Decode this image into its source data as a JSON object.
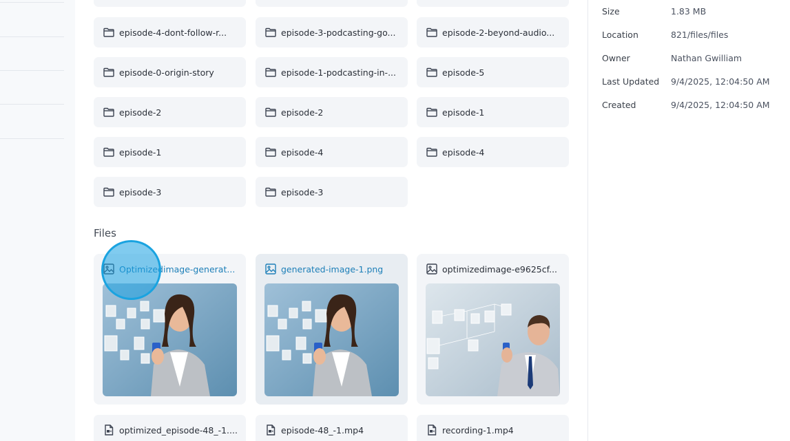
{
  "folders": [
    {
      "name": "episode-4-dont-follow-r..."
    },
    {
      "name": "episode-3-podcasting-go..."
    },
    {
      "name": "episode-2-beyond-audio..."
    },
    {
      "name": "episode-0-origin-story"
    },
    {
      "name": "episode-1-podcasting-in-..."
    },
    {
      "name": "episode-5"
    },
    {
      "name": "episode-2"
    },
    {
      "name": "episode-2"
    },
    {
      "name": "episode-1"
    },
    {
      "name": "episode-1"
    },
    {
      "name": "episode-4"
    },
    {
      "name": "episode-4"
    },
    {
      "name": "episode-3"
    },
    {
      "name": "episode-3"
    }
  ],
  "files_section": {
    "title": "Files"
  },
  "image_files": [
    {
      "name": "Optimizedimage-generat..."
    },
    {
      "name": "generated-image-1.png"
    },
    {
      "name": "optimizedimage-e9625cf..."
    }
  ],
  "video_files": [
    {
      "name": "optimized_episode-48_-1...."
    },
    {
      "name": "episode-48_-1.mp4"
    },
    {
      "name": "recording-1.mp4"
    }
  ],
  "details": {
    "size_label": "Size",
    "size_value": "1.83 MB",
    "location_label": "Location",
    "location_value": "821/files/files",
    "owner_label": "Owner",
    "owner_value": "Nathan Gwilliam",
    "updated_label": "Last Updated",
    "updated_value": "9/4/2025, 12:04:50 AM",
    "created_label": "Created",
    "created_value": "9/4/2025, 12:04:50 AM"
  },
  "colors": {
    "accent": "#1d7fb8",
    "cursor": "#1aa3e0",
    "card_bg": "#f3f5f8"
  }
}
